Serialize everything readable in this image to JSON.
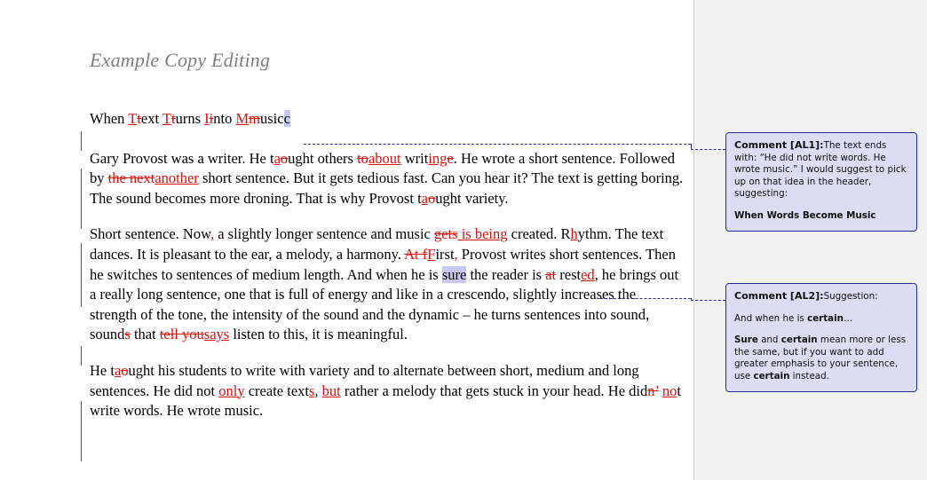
{
  "document": {
    "title": "Example Copy Editing",
    "heading": {
      "prefix": "When ",
      "segments": [
        {
          "ins": "T",
          "del": "t",
          "rest": "ext "
        },
        {
          "ins": "T",
          "del": "t",
          "rest": "urns "
        },
        {
          "ins": "I",
          "del": "i",
          "rest": "nto "
        },
        {
          "ins": "M",
          "del": "m",
          "rest": "usic"
        }
      ],
      "anchor_caret": "c"
    },
    "paragraph_2": {
      "t1": "Gary Provost was a writer. He t",
      "ins1": "a",
      "del1": "o",
      "t2": "ught others ",
      "del2": "to",
      "ins2": "about",
      "t3": " writ",
      "ins3": "ing",
      "del3": "e",
      "t4": ". He wrote a short sentence. Followed by ",
      "del4": "the next",
      "ins4": "another",
      "t5": " short sentence.  But it gets tedious fast. Can you hear it? The text is getting boring. The sound becomes more droning. That is why Provost t",
      "ins5": "a",
      "del5": "o",
      "t6": "ught variety."
    },
    "paragraph_3": {
      "t1": "Short sentence. Now",
      "ins1": ",",
      "t2": " a slightly longer sentence and music ",
      "del1": "gets",
      "ins2": " is being",
      "t3": " created. R",
      "ins3": "h",
      "t4": "ythm. The text dances. It is pleasant to the ear, a melody, a harmony. ",
      "del2": "At f",
      "ins4": "F",
      "t5": "irst",
      "ins5": ",",
      "t6": " Provost writes short sentences. Then he switches to sentences of medium length. And when he is ",
      "anchor": "sure",
      "t7": " the reader is ",
      "del3": "at",
      "t8": " rest",
      "ins6": "ed",
      "t9": ", he brings out a really long sentence, one that is full of energy and like in a crescendo, slightly increases the strength of the tone, the intensity of the sound and the dynamic – he turns sentences into sound, sound",
      "del4": "s",
      "t10": " that ",
      "del5": "tell you",
      "ins7": "says",
      "t11": " listen to this, it is meaningful."
    },
    "paragraph_4": {
      "t1": "He t",
      "ins1": "a",
      "del1": "o",
      "t2": "ught his students to write with variety and to alternate between short, medium and long sentences. He did not ",
      "ins2": "only",
      "t3": " create text",
      "ins3": "s",
      "t4": ", ",
      "ins4": "but",
      "t5": " rather a melody that gets stuck in your head. He did",
      "del2": "n’",
      "t6": " ",
      "ins5": "no",
      "t7": "t write words. He wrote music."
    }
  },
  "comments": [
    {
      "id": "AL1",
      "label": "Comment [AL1]:",
      "lines": [
        {
          "text": "The text ends with: “He did not write words. He wrote music.” I would suggest to pick up on that idea in the header, suggesting:",
          "bold": false,
          "gap": false
        },
        {
          "text": "When Words Become Music",
          "bold": true,
          "gap": true
        }
      ]
    },
    {
      "id": "AL2",
      "label": "Comment [AL2]:",
      "lines": [
        {
          "text": "Suggestion:",
          "bold": false,
          "gap": false
        },
        {
          "text": "And when he is certain…",
          "bold": false,
          "gap": true
        },
        {
          "text": "Sure and certain mean more or less the same, but if you want to add greater emphasis to your sentence, use certain instead.",
          "bold": false,
          "gap": true
        }
      ]
    }
  ],
  "colors": {
    "revision_red": "#d81111",
    "comment_bg": "#dcdcf4",
    "comment_border": "#2b2b8f",
    "anchor_highlight": "#c8c8ee",
    "page_bg": "#ffffff",
    "gutter_bg": "#f2f2f2",
    "title_gray": "#808080"
  }
}
